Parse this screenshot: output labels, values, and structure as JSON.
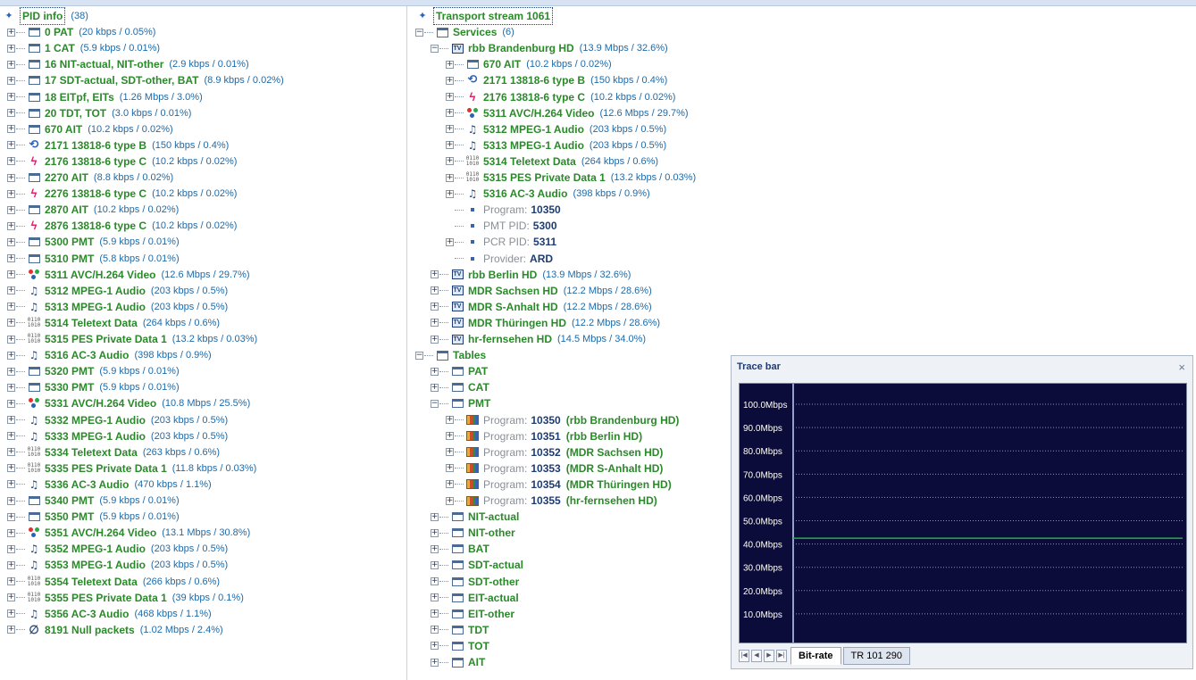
{
  "left": {
    "root_label": "PID info",
    "root_count": "(38)",
    "items": [
      {
        "icon": "table-icon",
        "text": "0  PAT",
        "detail": "(20 kbps / 0.05%)"
      },
      {
        "icon": "table-icon",
        "text": "1  CAT",
        "detail": "(5.9 kbps / 0.01%)"
      },
      {
        "icon": "table-icon",
        "text": "16  NIT-actual, NIT-other",
        "detail": "(2.9 kbps / 0.01%)"
      },
      {
        "icon": "table-icon",
        "text": "17  SDT-actual, SDT-other, BAT",
        "detail": "(8.9 kbps / 0.02%)"
      },
      {
        "icon": "table-icon",
        "text": "18  EITpf, EITs",
        "detail": "(1.26 Mbps / 3.0%)"
      },
      {
        "icon": "table-icon",
        "text": "20  TDT, TOT",
        "detail": "(3.0 kbps / 0.01%)"
      },
      {
        "icon": "table-icon",
        "text": "670  AIT",
        "detail": "(10.2 kbps / 0.02%)"
      },
      {
        "icon": "loop-icon",
        "text": "2171  13818-6 type B",
        "detail": "(150 kbps / 0.4%)"
      },
      {
        "icon": "bolt-icon",
        "text": "2176  13818-6 type C",
        "detail": "(10.2 kbps / 0.02%)"
      },
      {
        "icon": "table-icon",
        "text": "2270  AIT",
        "detail": "(8.8 kbps / 0.02%)"
      },
      {
        "icon": "bolt-icon",
        "text": "2276  13818-6 type C",
        "detail": "(10.2 kbps / 0.02%)"
      },
      {
        "icon": "table-icon",
        "text": "2870  AIT",
        "detail": "(10.2 kbps / 0.02%)"
      },
      {
        "icon": "bolt-icon",
        "text": "2876  13818-6 type C",
        "detail": "(10.2 kbps / 0.02%)"
      },
      {
        "icon": "table-icon",
        "text": "5300  PMT",
        "detail": "(5.9 kbps / 0.01%)"
      },
      {
        "icon": "table-icon",
        "text": "5310  PMT",
        "detail": "(5.8 kbps / 0.01%)"
      },
      {
        "icon": "video-icon",
        "text": "5311  AVC/H.264 Video",
        "detail": "(12.6 Mbps / 29.7%)"
      },
      {
        "icon": "audio-icon",
        "text": "5312  MPEG-1 Audio",
        "detail": "(203 kbps / 0.5%)"
      },
      {
        "icon": "audio-icon",
        "text": "5313  MPEG-1 Audio",
        "detail": "(203 kbps / 0.5%)"
      },
      {
        "icon": "binary-icon",
        "text": "5314  Teletext Data",
        "detail": "(264 kbps / 0.6%)"
      },
      {
        "icon": "binary-icon",
        "text": "5315  PES Private Data 1",
        "detail": "(13.2 kbps / 0.03%)"
      },
      {
        "icon": "audio-icon",
        "text": "5316  AC-3 Audio",
        "detail": "(398 kbps / 0.9%)"
      },
      {
        "icon": "table-icon",
        "text": "5320  PMT",
        "detail": "(5.9 kbps / 0.01%)"
      },
      {
        "icon": "table-icon",
        "text": "5330  PMT",
        "detail": "(5.9 kbps / 0.01%)"
      },
      {
        "icon": "video-icon",
        "text": "5331  AVC/H.264 Video",
        "detail": "(10.8 Mbps / 25.5%)"
      },
      {
        "icon": "audio-icon",
        "text": "5332  MPEG-1 Audio",
        "detail": "(203 kbps / 0.5%)"
      },
      {
        "icon": "audio-icon",
        "text": "5333  MPEG-1 Audio",
        "detail": "(203 kbps / 0.5%)"
      },
      {
        "icon": "binary-icon",
        "text": "5334  Teletext Data",
        "detail": "(263 kbps / 0.6%)"
      },
      {
        "icon": "binary-icon",
        "text": "5335  PES Private Data 1",
        "detail": "(11.8 kbps / 0.03%)"
      },
      {
        "icon": "audio-icon",
        "text": "5336  AC-3 Audio",
        "detail": "(470 kbps / 1.1%)"
      },
      {
        "icon": "table-icon",
        "text": "5340  PMT",
        "detail": "(5.9 kbps / 0.01%)"
      },
      {
        "icon": "table-icon",
        "text": "5350  PMT",
        "detail": "(5.9 kbps / 0.01%)"
      },
      {
        "icon": "video-icon",
        "text": "5351  AVC/H.264 Video",
        "detail": "(13.1 Mbps / 30.8%)"
      },
      {
        "icon": "audio-icon",
        "text": "5352  MPEG-1 Audio",
        "detail": "(203 kbps / 0.5%)"
      },
      {
        "icon": "audio-icon",
        "text": "5353  MPEG-1 Audio",
        "detail": "(203 kbps / 0.5%)"
      },
      {
        "icon": "binary-icon",
        "text": "5354  Teletext Data",
        "detail": "(266 kbps / 0.6%)"
      },
      {
        "icon": "binary-icon",
        "text": "5355  PES Private Data 1",
        "detail": "(39 kbps / 0.1%)"
      },
      {
        "icon": "audio-icon",
        "text": "5356  AC-3 Audio",
        "detail": "(468 kbps / 1.1%)"
      },
      {
        "icon": "null-icon",
        "text": "8191  Null packets",
        "detail": "(1.02 Mbps / 2.4%)"
      }
    ]
  },
  "right": {
    "rows": [
      {
        "level": 0,
        "icon": "pin-icon",
        "text": "Transport stream  1061",
        "detail": "",
        "expander": "none",
        "style": "root"
      },
      {
        "level": 0,
        "icon": "services-icon",
        "text": "Services",
        "detail": "(6)",
        "expander": "minus",
        "style": "green"
      },
      {
        "level": 1,
        "icon": "tv-icon",
        "text": "rbb Brandenburg HD",
        "detail": "(13.9 Mbps / 32.6%)",
        "expander": "minus",
        "style": "green"
      },
      {
        "level": 2,
        "icon": "table-icon",
        "text": "670  AIT",
        "detail": "(10.2 kbps / 0.02%)",
        "expander": "plus",
        "style": "green"
      },
      {
        "level": 2,
        "icon": "loop-icon",
        "text": "2171  13818-6 type B",
        "detail": "(150 kbps / 0.4%)",
        "expander": "plus",
        "style": "green"
      },
      {
        "level": 2,
        "icon": "bolt-icon",
        "text": "2176  13818-6 type C",
        "detail": "(10.2 kbps / 0.02%)",
        "expander": "plus",
        "style": "green"
      },
      {
        "level": 2,
        "icon": "video-icon",
        "text": "5311  AVC/H.264 Video",
        "detail": "(12.6 Mbps / 29.7%)",
        "expander": "plus",
        "style": "green"
      },
      {
        "level": 2,
        "icon": "audio-icon",
        "text": "5312  MPEG-1 Audio",
        "detail": "(203 kbps / 0.5%)",
        "expander": "plus",
        "style": "green"
      },
      {
        "level": 2,
        "icon": "audio-icon",
        "text": "5313  MPEG-1 Audio",
        "detail": "(203 kbps / 0.5%)",
        "expander": "plus",
        "style": "green"
      },
      {
        "level": 2,
        "icon": "binary-icon",
        "text": "5314  Teletext Data",
        "detail": "(264 kbps / 0.6%)",
        "expander": "plus",
        "style": "green"
      },
      {
        "level": 2,
        "icon": "binary-icon",
        "text": "5315  PES Private Data 1",
        "detail": "(13.2 kbps / 0.03%)",
        "expander": "plus",
        "style": "green"
      },
      {
        "level": 2,
        "icon": "audio-icon",
        "text": "5316  AC-3 Audio",
        "detail": "(398 kbps / 0.9%)",
        "expander": "plus",
        "style": "green"
      },
      {
        "level": 2,
        "icon": "dot-icon",
        "key": "Program:",
        "text": "10350",
        "detail": "",
        "expander": "none",
        "style": "kv"
      },
      {
        "level": 2,
        "icon": "dot-icon",
        "key": "PMT PID:",
        "text": "5300",
        "detail": "",
        "expander": "none",
        "style": "kv"
      },
      {
        "level": 2,
        "icon": "dot-icon",
        "key": "PCR PID:",
        "text": "5311",
        "detail": "",
        "expander": "plus",
        "style": "kv"
      },
      {
        "level": 2,
        "icon": "dot-icon",
        "key": "Provider:",
        "text": "ARD",
        "detail": "",
        "expander": "none",
        "style": "kv"
      },
      {
        "level": 1,
        "icon": "tv-icon",
        "text": "rbb Berlin HD",
        "detail": "(13.9 Mbps / 32.6%)",
        "expander": "plus",
        "style": "green"
      },
      {
        "level": 1,
        "icon": "tv-icon",
        "text": "MDR Sachsen HD",
        "detail": "(12.2 Mbps / 28.6%)",
        "expander": "plus",
        "style": "green"
      },
      {
        "level": 1,
        "icon": "tv-icon",
        "text": "MDR S-Anhalt HD",
        "detail": "(12.2 Mbps / 28.6%)",
        "expander": "plus",
        "style": "green"
      },
      {
        "level": 1,
        "icon": "tv-icon",
        "text": "MDR Thüringen HD",
        "detail": "(12.2 Mbps / 28.6%)",
        "expander": "plus",
        "style": "green"
      },
      {
        "level": 1,
        "icon": "tv-icon",
        "text": "hr-fernsehen HD",
        "detail": "(14.5 Mbps / 34.0%)",
        "expander": "plus",
        "style": "green"
      },
      {
        "level": 0,
        "icon": "tables-icon",
        "text": "Tables",
        "detail": "",
        "expander": "minus",
        "style": "green"
      },
      {
        "level": 1,
        "icon": "table-icon",
        "text": "PAT",
        "detail": "",
        "expander": "plus",
        "style": "green"
      },
      {
        "level": 1,
        "icon": "table-icon",
        "text": "CAT",
        "detail": "",
        "expander": "plus",
        "style": "green"
      },
      {
        "level": 1,
        "icon": "table-icon",
        "text": "PMT",
        "detail": "",
        "expander": "minus",
        "style": "green"
      },
      {
        "level": 2,
        "icon": "program-icon",
        "key": "Program:",
        "text": "10350",
        "detail": "(rbb Brandenburg HD)",
        "expander": "plus",
        "style": "prog"
      },
      {
        "level": 2,
        "icon": "program-icon",
        "key": "Program:",
        "text": "10351",
        "detail": "(rbb Berlin HD)",
        "expander": "plus",
        "style": "prog"
      },
      {
        "level": 2,
        "icon": "program-icon",
        "key": "Program:",
        "text": "10352",
        "detail": "(MDR Sachsen HD)",
        "expander": "plus",
        "style": "prog"
      },
      {
        "level": 2,
        "icon": "program-icon",
        "key": "Program:",
        "text": "10353",
        "detail": "(MDR S-Anhalt HD)",
        "expander": "plus",
        "style": "prog"
      },
      {
        "level": 2,
        "icon": "program-icon",
        "key": "Program:",
        "text": "10354",
        "detail": "(MDR Thüringen HD)",
        "expander": "plus",
        "style": "prog"
      },
      {
        "level": 2,
        "icon": "program-icon",
        "key": "Program:",
        "text": "10355",
        "detail": "(hr-fernsehen HD)",
        "expander": "plus",
        "style": "prog"
      },
      {
        "level": 1,
        "icon": "table-icon",
        "text": "NIT-actual",
        "detail": "",
        "expander": "plus",
        "style": "green"
      },
      {
        "level": 1,
        "icon": "table-icon",
        "text": "NIT-other",
        "detail": "",
        "expander": "plus",
        "style": "green"
      },
      {
        "level": 1,
        "icon": "table-icon",
        "text": "BAT",
        "detail": "",
        "expander": "plus",
        "style": "green"
      },
      {
        "level": 1,
        "icon": "table-icon",
        "text": "SDT-actual",
        "detail": "",
        "expander": "plus",
        "style": "green"
      },
      {
        "level": 1,
        "icon": "table-icon",
        "text": "SDT-other",
        "detail": "",
        "expander": "plus",
        "style": "green"
      },
      {
        "level": 1,
        "icon": "table-icon",
        "text": "EIT-actual",
        "detail": "",
        "expander": "plus",
        "style": "green"
      },
      {
        "level": 1,
        "icon": "table-icon",
        "text": "EIT-other",
        "detail": "",
        "expander": "plus",
        "style": "green"
      },
      {
        "level": 1,
        "icon": "table-icon",
        "text": "TDT",
        "detail": "",
        "expander": "plus",
        "style": "green"
      },
      {
        "level": 1,
        "icon": "table-icon",
        "text": "TOT",
        "detail": "",
        "expander": "plus",
        "style": "green"
      },
      {
        "level": 1,
        "icon": "tables-icon",
        "text": "AIT",
        "detail": "",
        "expander": "plus",
        "style": "green"
      }
    ]
  },
  "trace_bar": {
    "title": "Trace bar",
    "close_glyph": "×",
    "tabs": [
      "Bit-rate",
      "TR 101 290"
    ],
    "nav_glyphs": [
      "|◀",
      "◀",
      "▶",
      "▶|"
    ],
    "y_labels": [
      "100.0Mbps",
      "90.0Mbps",
      "80.0Mbps",
      "70.0Mbps",
      "60.0Mbps",
      "50.0Mbps",
      "40.0Mbps",
      "30.0Mbps",
      "20.0Mbps",
      "10.0Mbps"
    ],
    "ymax": 105,
    "level_mbps": 42.5,
    "line_color": "#2aa84a",
    "plot_bg": "#0b0c3a"
  },
  "colors": {
    "green": "#2a8a2a",
    "blue": "#1e3c72",
    "detail": "#1e6aa8"
  }
}
